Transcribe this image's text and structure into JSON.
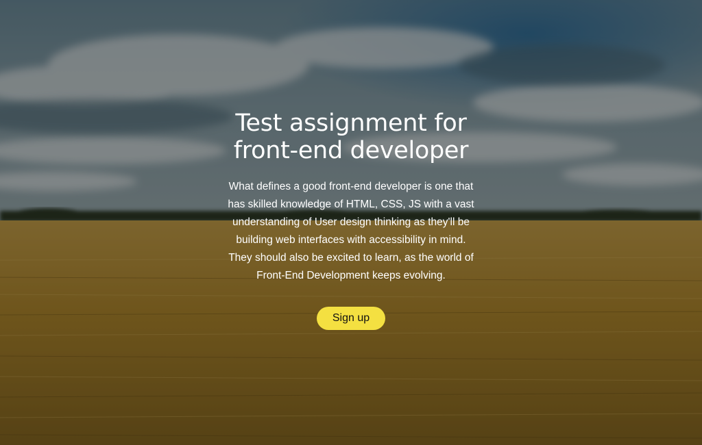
{
  "hero": {
    "title_lines": [
      "Test assignment for",
      "front-end developer"
    ],
    "description_lines": [
      "What defines a good front-end developer is one that",
      "has skilled knowledge of HTML, CSS, JS with a vast",
      "understanding of User design thinking as they'll be",
      "building web interfaces with accessibility in mind.",
      "They should also be excited to learn, as the world of",
      "Front-End Development keeps evolving."
    ],
    "signup_label": "Sign up",
    "background": "wheat-field-under-cloudy-sky",
    "colors": {
      "button": "#f4e041",
      "text": "#ffffff"
    }
  }
}
